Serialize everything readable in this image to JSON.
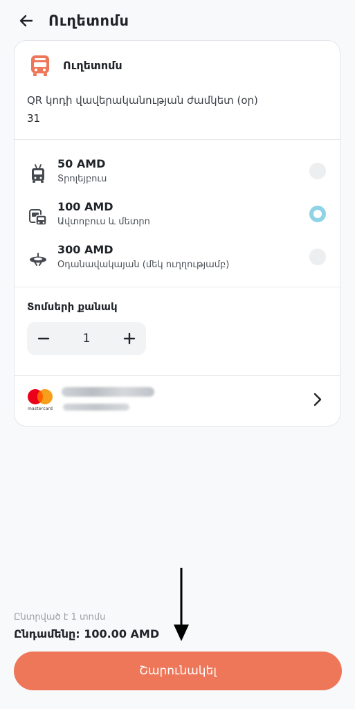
{
  "header": {
    "title": "Ուղետոմս",
    "back_icon": "arrow-left-icon"
  },
  "service": {
    "icon": "bus-icon",
    "icon_color": "#ee7659",
    "name": "Ուղետոմս",
    "validity_label": "QR կոդի վավերականության ժամկետ (օր)",
    "validity_value": "31"
  },
  "fares": [
    {
      "icon": "trolleybus-icon",
      "price": "50 AMD",
      "description": "Տրոլեյբուս",
      "selected": false
    },
    {
      "icon": "bus-metro-icon",
      "price": "100 AMD",
      "description": "Ավտոբուս և մետրո",
      "selected": true
    },
    {
      "icon": "cable-car-icon",
      "price": "300 AMD",
      "description": "Օդանավակայան (մեկ ուղղությամբ)",
      "selected": false
    }
  ],
  "quantity": {
    "label": "Տոմսերի քանակ",
    "value": "1",
    "minus_icon": "minus-icon",
    "plus_icon": "plus-icon"
  },
  "payment": {
    "card_brand": "mastercard",
    "card_number_masked": "•••• •••• •••• ••••",
    "card_subtitle": "•••••",
    "chevron_icon": "chevron-right-icon"
  },
  "footer": {
    "selected_count": "Ընտրված է 1 տոմս",
    "total": "Ընդամենը: 100.00 AMD",
    "pay_button": "Շարունակել",
    "accent_color": "#ee7659"
  }
}
